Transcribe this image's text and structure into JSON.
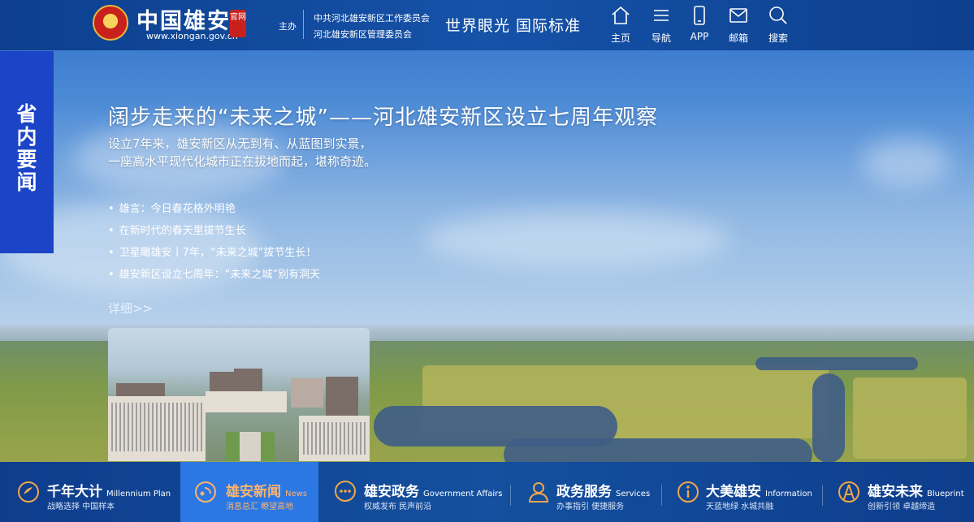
{
  "header": {
    "logo_text": "中国雄安",
    "logo_url": "www.xiongan.gov.cn",
    "official_badge": "官网",
    "host_label": "主办",
    "host_orgs": [
      "中共河北雄安新区工作委员会",
      "河北雄安新区管理委员会"
    ],
    "slogan": "世界眼光 国际标准",
    "nav": [
      {
        "label": "主页",
        "icon": "home-icon"
      },
      {
        "label": "导航",
        "icon": "menu-icon"
      },
      {
        "label": "APP",
        "icon": "phone-icon"
      },
      {
        "label": "邮箱",
        "icon": "mail-icon"
      },
      {
        "label": "搜索",
        "icon": "search-icon"
      }
    ]
  },
  "side_tab": {
    "label": "省内要闻"
  },
  "main": {
    "headline": "阔步走来的“未来之城”——河北雄安新区设立七周年观察",
    "summary": "设立7年来，雄安新区从无到有、从蓝图到实景，一座高水平现代化城市正在拔地而起，堪称奇迹。",
    "news": [
      "雄言：今日春花格外明艳",
      "在新时代的春天里拔节生长",
      "卫星瞰雄安丨7年，“未来之城”拔节生长！",
      "雄安新区设立七周年：“未来之城”别有洞天"
    ],
    "more_link": "详细>>"
  },
  "footer": {
    "tabs": [
      {
        "title": "千年大计",
        "en": "Millennium Plan",
        "sub": "战略选择 中国样本",
        "icon": "compass-icon",
        "active": false
      },
      {
        "title": "雄安新闻",
        "en": "News",
        "sub": "消息总汇 瞭望高地",
        "icon": "news-icon",
        "active": true
      },
      {
        "title": "雄安政务",
        "en": "Government Affairs",
        "sub": "权威发布 民声前沿",
        "icon": "chat-icon",
        "active": false
      },
      {
        "title": "政务服务",
        "en": "Services",
        "sub": "办事指引 便捷服务",
        "icon": "service-icon",
        "active": false
      },
      {
        "title": "大美雄安",
        "en": "Information",
        "sub": "天蓝地绿 水城共融",
        "icon": "info-icon",
        "active": false
      },
      {
        "title": "雄安未来",
        "en": "Blueprint",
        "sub": "创新引领 卓越缔造",
        "icon": "drafting-icon",
        "active": false
      }
    ]
  },
  "colors": {
    "header": "#0d3f8e",
    "side_tab": "#1b45c6",
    "active_tab": "#2b78e4",
    "active_text": "#ffb36b"
  }
}
